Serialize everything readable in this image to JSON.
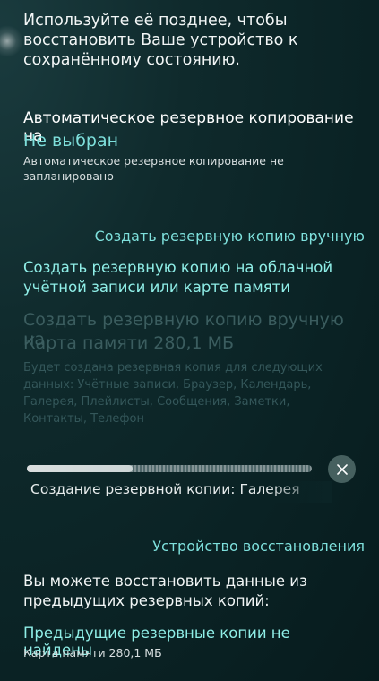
{
  "intro": {
    "text_line1": "Используйте её позднее, чтобы",
    "text_line2": "восстановить Ваше устройство к",
    "text_line3": "сохранённому состоянию."
  },
  "auto_backup": {
    "title": "Автоматическое резервное копирование на",
    "value": "Не выбран",
    "desc_line1": "Автоматическое резервное копирование не",
    "desc_line2": "запланировано"
  },
  "manual_section": {
    "header": "Создать резервную копию вручную",
    "cloud_link_line1": "Создать резервную копию на облачной",
    "cloud_link_line2": "учётной записи или карте памяти",
    "title": "Создать резервную копию вручную на",
    "target": "Карта памяти 280,1 МБ",
    "desc_line1": "Будет создана резервная копия для следующих",
    "desc_line2": "данных: Учётные записи, Браузер, Календарь,",
    "desc_line3": "Галерея, Плейлисты, Сообщения, Заметки,",
    "desc_line4": "Контакты, Телефон"
  },
  "progress": {
    "fraction": 0.37,
    "label": "Создание резервной копии: Галерея"
  },
  "restore_section": {
    "header": "Устройство восстановления",
    "desc_line1": "Вы можете восстановить данные из",
    "desc_line2": "предыдущих резервных копий:",
    "status": "Предыдущие резервные копии не найдены",
    "location": "Карта памяти 280,1 МБ"
  },
  "icons": {
    "cancel": "close-icon"
  },
  "colors": {
    "accent": "#7ee0dc",
    "link": "#8feee7",
    "disabled": "#3b5d5f",
    "background": "#0f2a2c"
  }
}
